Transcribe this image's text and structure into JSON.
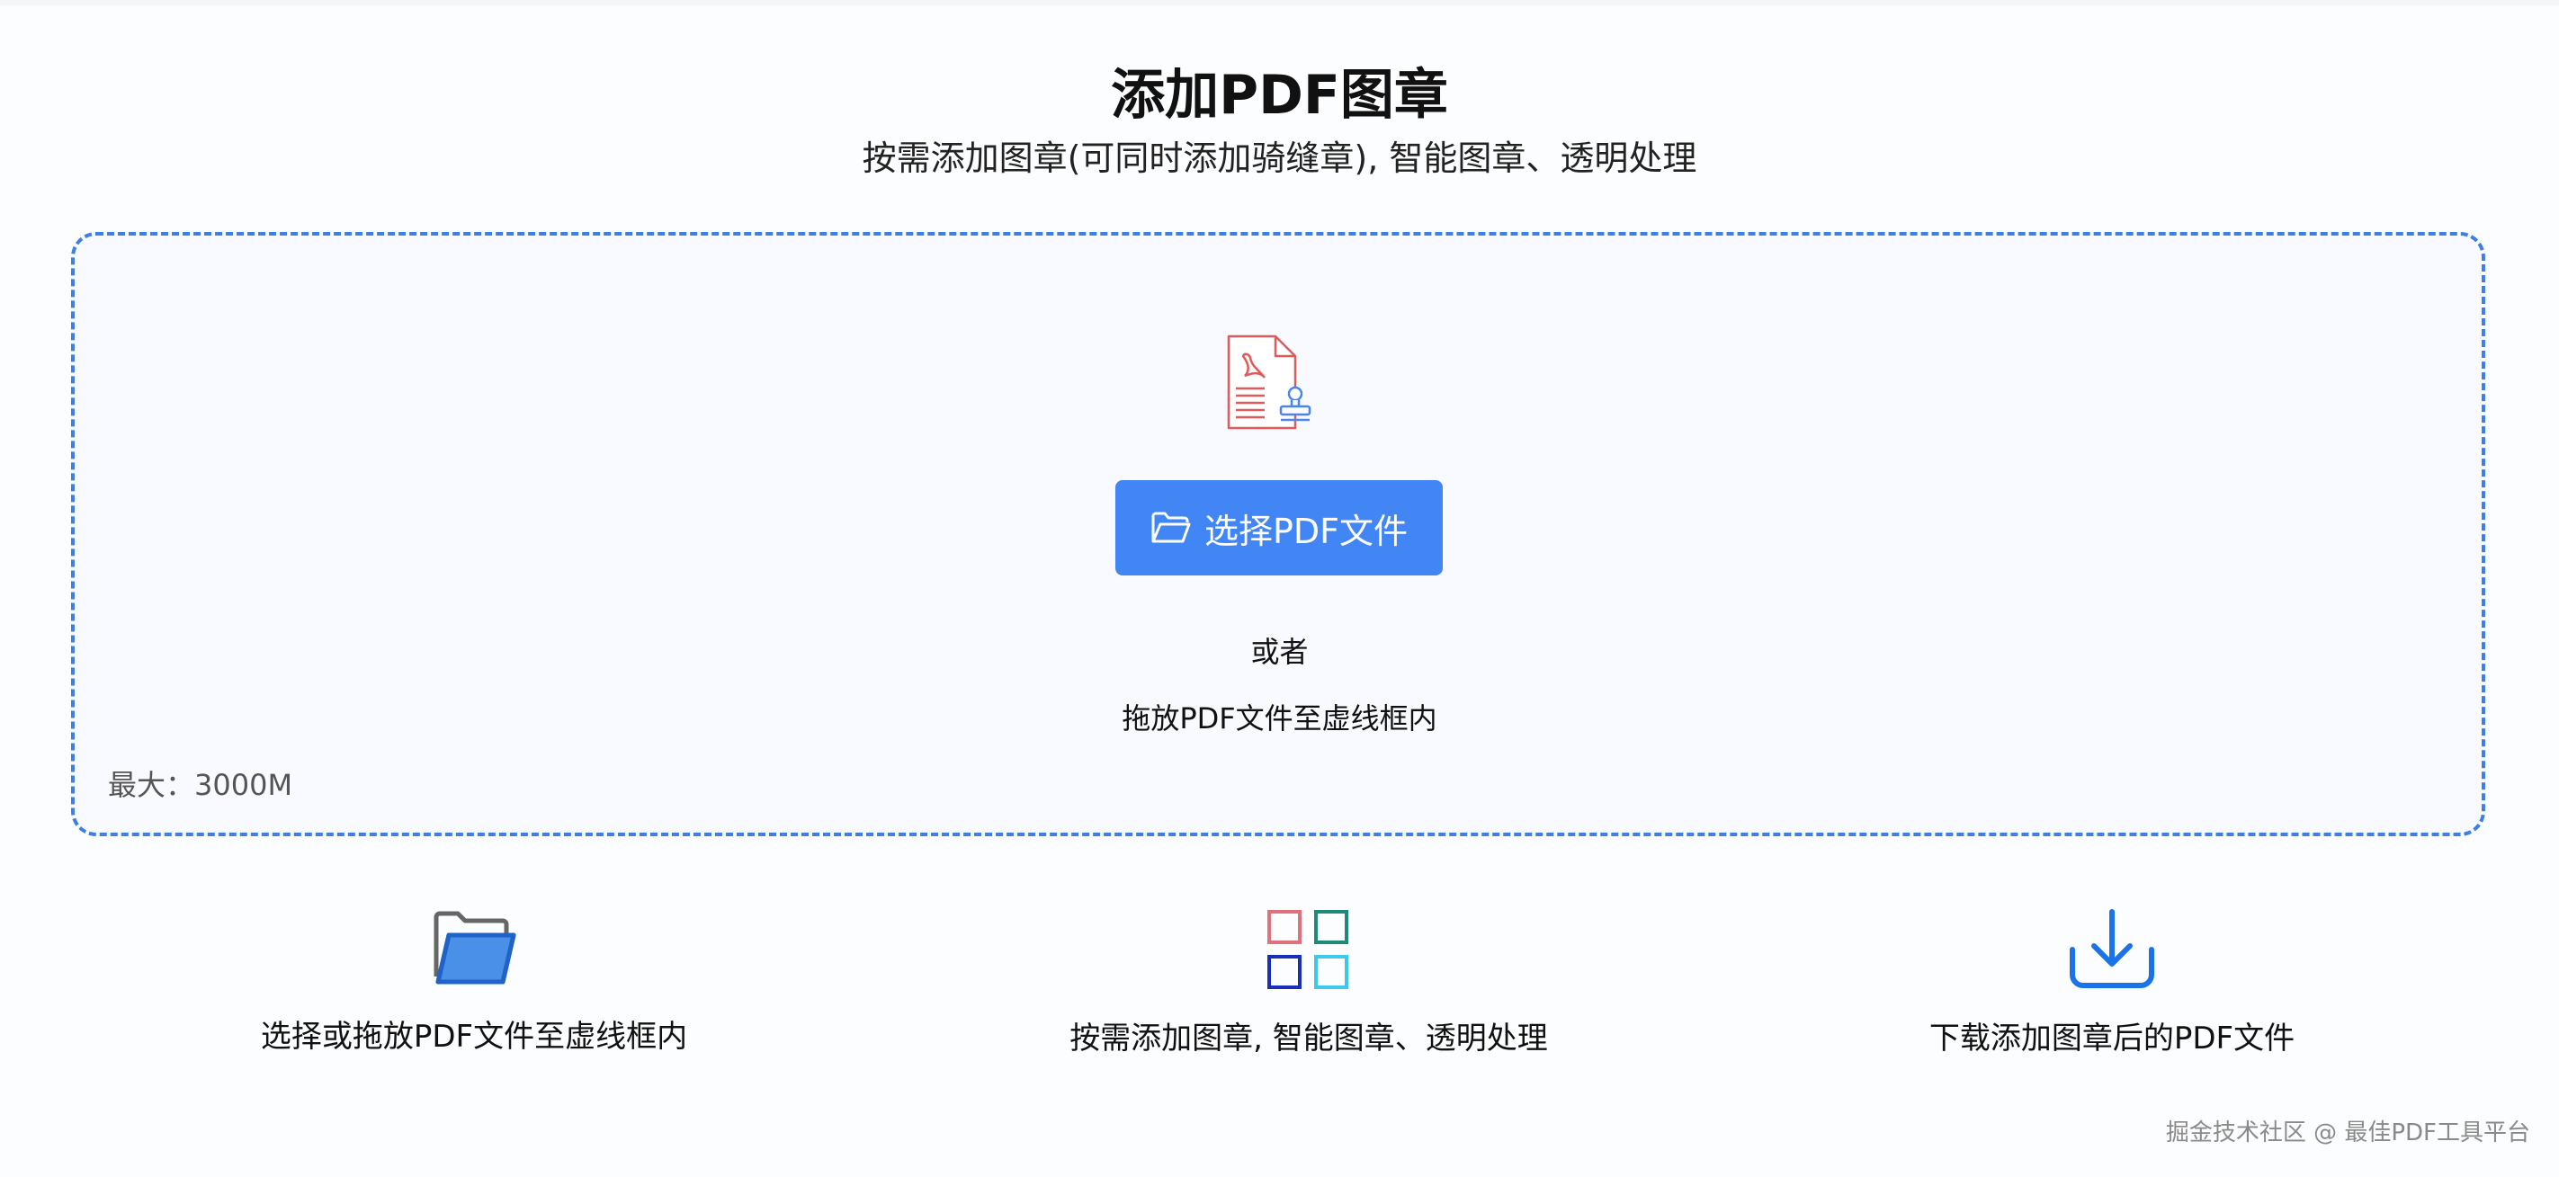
{
  "header": {
    "title": "添加PDF图章",
    "subtitle": "按需添加图章(可同时添加骑缝章), 智能图章、透明处理"
  },
  "upload": {
    "button_label": "选择PDF文件",
    "or_text": "或者",
    "drag_hint": "拖放PDF文件至虚线框内",
    "max_size": "最大：3000M"
  },
  "steps": [
    {
      "icon": "folder-icon",
      "label": "选择或拖放PDF文件至虚线框内"
    },
    {
      "icon": "grid-squares-icon",
      "label": "按需添加图章, 智能图章、透明处理"
    },
    {
      "icon": "download-icon",
      "label": "下载添加图章后的PDF文件"
    }
  ],
  "watermark": "掘金技术社区 @ 最佳PDF工具平台",
  "colors": {
    "accent": "#4285f4",
    "dropzone_border": "#3d7fe3",
    "pdf_red": "#e05a5a"
  }
}
